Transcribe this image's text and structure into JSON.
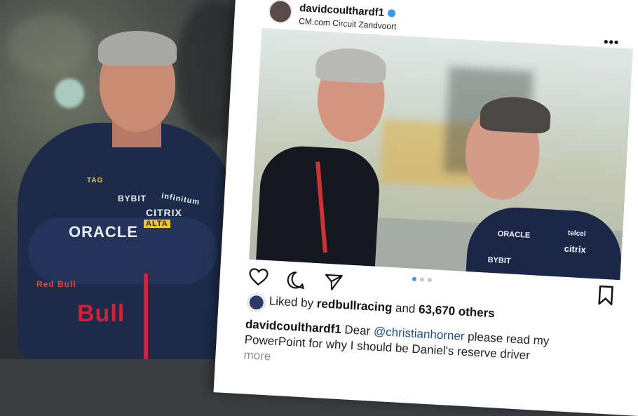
{
  "left_photo": {
    "suit_texts": [
      "ORACLE",
      "CITRIX",
      "BYBIT",
      "infinitum",
      "Red Bull",
      "TAG",
      "Bull",
      "ALTA"
    ]
  },
  "post": {
    "username": "davidcoulthardf1",
    "location": "CM.com Circuit Zandvoort",
    "more_icon": "more-horizontal-icon",
    "image_texts": [
      "ORACLE",
      "citrix",
      "BYBIT",
      "telcel"
    ],
    "actions": {
      "like_icon": "heart-icon",
      "comment_icon": "comment-icon",
      "share_icon": "send-icon",
      "save_icon": "bookmark-icon"
    },
    "carousel": {
      "count": 3,
      "active_index": 0
    },
    "likes": {
      "prefix": "Liked by",
      "user": "redbullracing",
      "middle": "and",
      "count": "63,670 others"
    },
    "caption": {
      "user": "davidcoulthardf1",
      "text_before": "Dear",
      "mention": "@christianhorner",
      "text_after": "please read my PowerPoint for why I should be Daniel's reserve driver",
      "more": "more"
    },
    "colors": {
      "verified": "#3897f0",
      "mention": "#1f4f86",
      "active_dot": "#3897f0"
    }
  }
}
